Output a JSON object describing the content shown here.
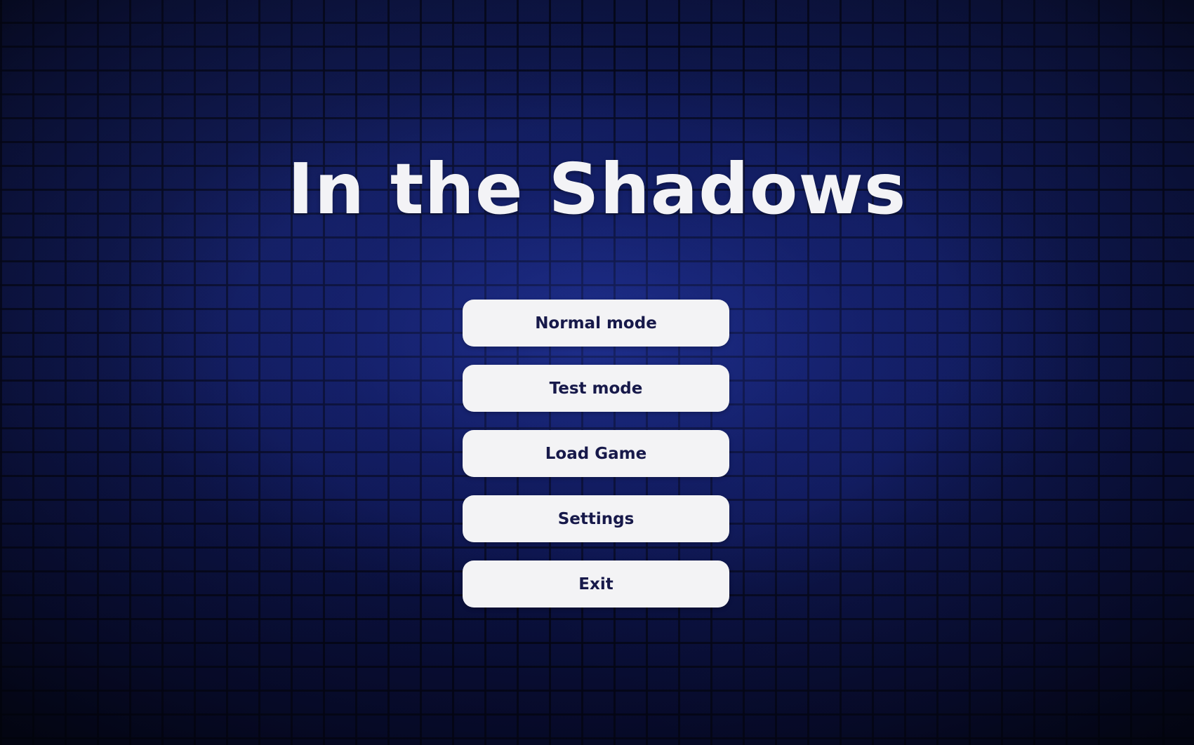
{
  "title": "In the Shadows",
  "menu": {
    "items": [
      {
        "label": "Normal mode"
      },
      {
        "label": "Test mode"
      },
      {
        "label": "Load Game"
      },
      {
        "label": "Settings"
      },
      {
        "label": "Exit"
      }
    ]
  },
  "colors": {
    "background": "#0d1440",
    "title_text": "#f3f3f6",
    "button_background": "#f3f3f5",
    "button_text": "#17194a"
  }
}
